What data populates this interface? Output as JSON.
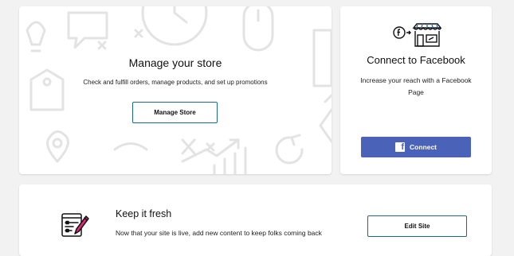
{
  "store_card": {
    "title": "Manage your store",
    "description": "Check and fulfill orders, manage products, and set up promotions",
    "button_label": "Manage Store"
  },
  "facebook_card": {
    "title": "Connect to Facebook",
    "description": "Increase your reach with a Facebook Page",
    "button_label": "Connect",
    "button_icon": "facebook-logo-icon",
    "illustration_icon": "facebook-storefront-icon",
    "logo_letter": "f",
    "colors": {
      "button": "#4a63b8"
    }
  },
  "fresh_card": {
    "title": "Keep it fresh",
    "description": "Now that your site is live, add new content to keep folks coming back",
    "button_label": "Edit Site",
    "illustration_icon": "edit-document-icon"
  },
  "colors": {
    "accent_outline": "#1b6a89",
    "pencil": "#e0287a",
    "background": "#f2f2f2"
  }
}
